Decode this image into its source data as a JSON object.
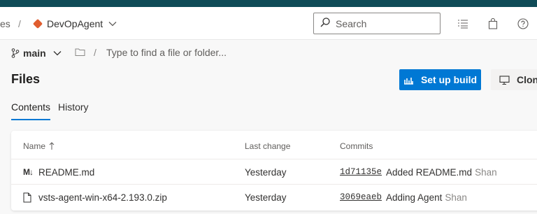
{
  "header": {
    "crumb_prev": "es",
    "crumb_sep": "/",
    "repo_name": "DevOpAgent",
    "search_placeholder": "Search"
  },
  "pathbar": {
    "branch": "main",
    "separator": "/",
    "path_placeholder": "Type to find a file or folder..."
  },
  "page": {
    "title": "Files",
    "setup_build_label": "Set up build",
    "clone_label": "Clone"
  },
  "tabs": [
    {
      "label": "Contents",
      "selected": true
    },
    {
      "label": "History",
      "selected": false
    }
  ],
  "table": {
    "columns": {
      "name": "Name",
      "last_change": "Last change",
      "commits": "Commits"
    },
    "rows": [
      {
        "icon": "markdown-icon",
        "icon_text": "M↓",
        "name": "README.md",
        "last_change": "Yesterday",
        "commit_hash": "1d71135e",
        "commit_message": "Added README.md",
        "author": "Shan"
      },
      {
        "icon": "file-icon",
        "name": "vsts-agent-win-x64-2.193.0.zip",
        "last_change": "Yesterday",
        "commit_hash": "3069eaeb",
        "commit_message": "Adding Agent",
        "author": "Shan"
      }
    ]
  },
  "colors": {
    "accent": "#0078d4",
    "topbar": "#0f4b57",
    "repo_icon": "#e05d2f"
  }
}
